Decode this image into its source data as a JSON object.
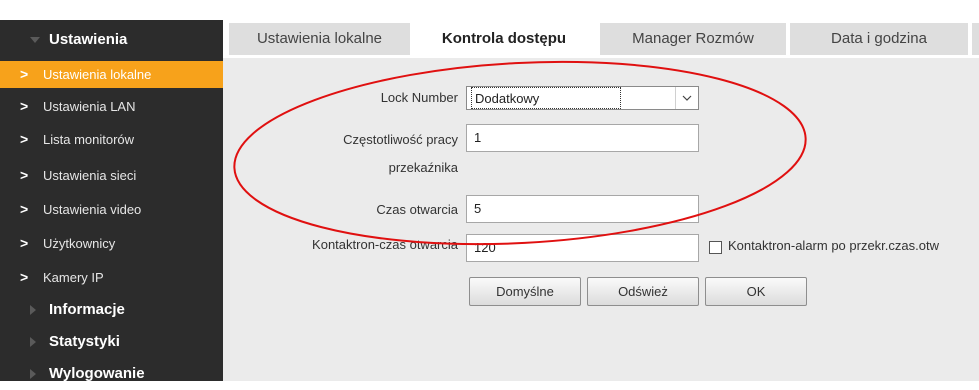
{
  "sidebar": {
    "sections": [
      {
        "label": "Ustawienia",
        "expanded": true
      },
      {
        "label": "Informacje",
        "expanded": false
      },
      {
        "label": "Statystyki",
        "expanded": false
      },
      {
        "label": "Wylogowanie",
        "expanded": false
      }
    ],
    "items": [
      {
        "label": "Ustawienia lokalne",
        "active": true
      },
      {
        "label": "Ustawienia LAN"
      },
      {
        "label": "Lista monitorów"
      },
      {
        "label": "Ustawienia sieci"
      },
      {
        "label": "Ustawienia video"
      },
      {
        "label": "Użytkownicy"
      },
      {
        "label": "Kamery IP"
      }
    ]
  },
  "tabs": [
    {
      "label": "Ustawienia lokalne"
    },
    {
      "label": "Kontrola dostępu",
      "active": true
    },
    {
      "label": "Manager Rozmów"
    },
    {
      "label": "Data i godzina"
    }
  ],
  "form": {
    "lock_number": {
      "label": "Lock Number",
      "value": "Dodatkowy"
    },
    "relay_frequency": {
      "label_line1": "Częstotliwość pracy",
      "label_line2": "przekaźnika",
      "value": "1"
    },
    "open_time": {
      "label": "Czas otwarcia",
      "value": "5"
    },
    "contact_open_time": {
      "label": "Kontaktron-czas otwarcia",
      "value": "120"
    },
    "contact_alarm": {
      "label": "Kontaktron-alarm po przekr.czas.otw",
      "checked": false
    }
  },
  "buttons": {
    "defaults": "Domyślne",
    "refresh": "Odśwież",
    "ok": "OK"
  },
  "colors": {
    "sidebar_bg": "#2c2c2c",
    "active_item": "#f7a21b",
    "annotation_ellipse": "#e01010",
    "content_bg": "#ebebeb"
  }
}
